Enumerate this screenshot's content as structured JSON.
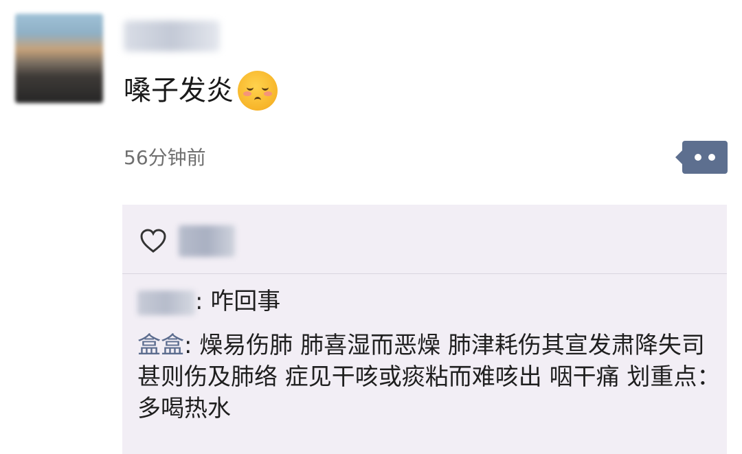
{
  "post": {
    "text": "嗓子发炎",
    "emoji": "blushing-face-emoji",
    "timestamp": "56分钟前"
  },
  "interactions": {
    "more_icon": "more-dots-icon",
    "like_icon": "heart-outline-icon"
  },
  "comments": [
    {
      "author": "",
      "separator": ":",
      "text": " 咋回事"
    },
    {
      "author": "盒盒",
      "separator": ":",
      "text": " 燥易伤肺 肺喜湿而恶燥 肺津耗伤其宣发肃降失司 甚则伤及肺络 症见干咳或痰粘而难咳出 咽干痛 划重点：多喝热水"
    }
  ],
  "colors": {
    "commenter": "#5b6c8e",
    "more_button": "#5d6f8f",
    "comment_bg": "#f2eef5"
  }
}
